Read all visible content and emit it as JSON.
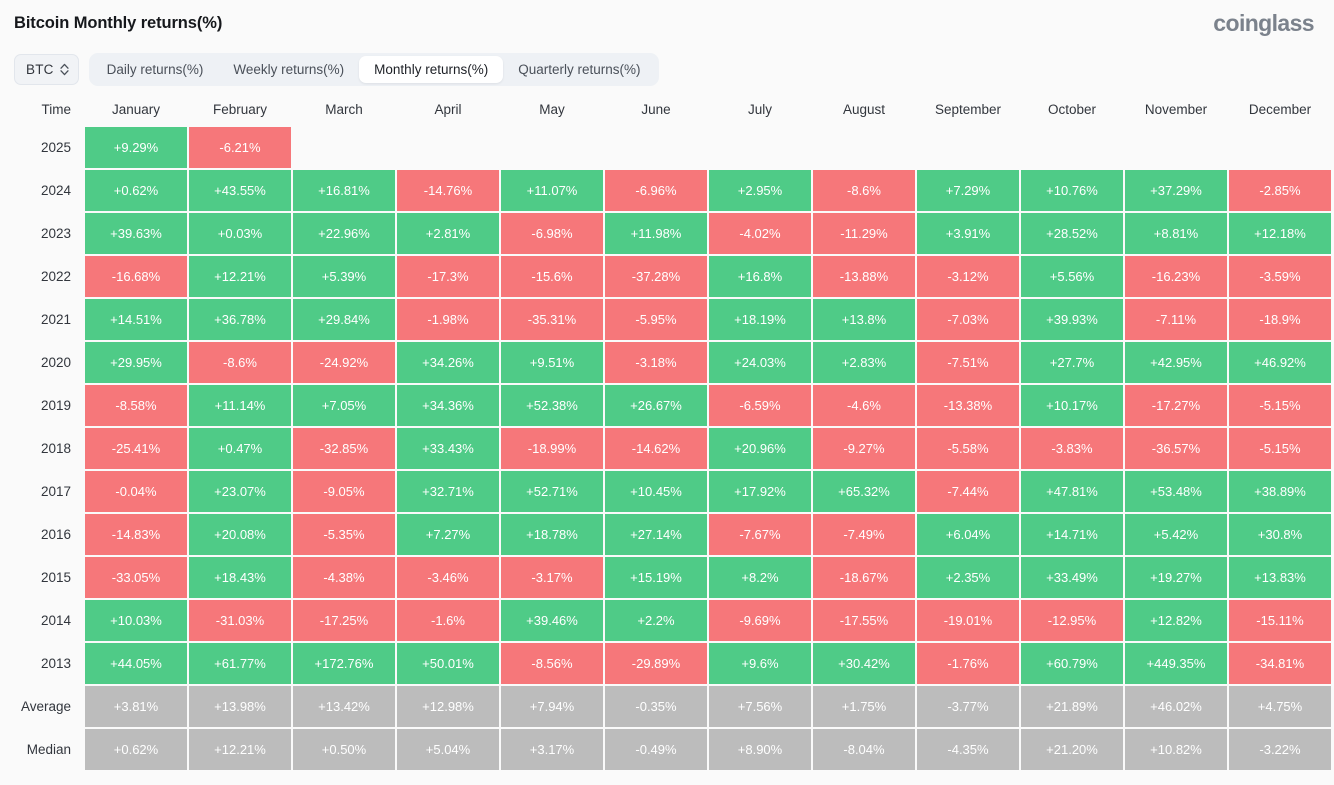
{
  "header": {
    "title": "Bitcoin Monthly returns(%)",
    "brand": "coinglass"
  },
  "controls": {
    "symbol": "BTC",
    "tabs": [
      {
        "label": "Daily returns(%)",
        "active": false
      },
      {
        "label": "Weekly returns(%)",
        "active": false
      },
      {
        "label": "Monthly returns(%)",
        "active": true
      },
      {
        "label": "Quarterly returns(%)",
        "active": false
      }
    ]
  },
  "colors": {
    "positive": "#4fcb87",
    "negative": "#f6777a",
    "neutral": "#bcbcbc",
    "background": "#fafafa",
    "tab_bar": "#eef1f5"
  },
  "chart_data": {
    "type": "heatmap",
    "title": "Bitcoin Monthly returns(%)",
    "xlabel": "",
    "ylabel": "Time",
    "row_header": "Time",
    "categories": [
      "January",
      "February",
      "March",
      "April",
      "May",
      "June",
      "July",
      "August",
      "September",
      "October",
      "November",
      "December"
    ],
    "rows": [
      {
        "label": "2025",
        "kind": "year",
        "values": [
          "+9.29%",
          "-6.21%",
          "",
          "",
          "",
          "",
          "",
          "",
          "",
          "",
          "",
          ""
        ]
      },
      {
        "label": "2024",
        "kind": "year",
        "values": [
          "+0.62%",
          "+43.55%",
          "+16.81%",
          "-14.76%",
          "+11.07%",
          "-6.96%",
          "+2.95%",
          "-8.6%",
          "+7.29%",
          "+10.76%",
          "+37.29%",
          "-2.85%"
        ]
      },
      {
        "label": "2023",
        "kind": "year",
        "values": [
          "+39.63%",
          "+0.03%",
          "+22.96%",
          "+2.81%",
          "-6.98%",
          "+11.98%",
          "-4.02%",
          "-11.29%",
          "+3.91%",
          "+28.52%",
          "+8.81%",
          "+12.18%"
        ]
      },
      {
        "label": "2022",
        "kind": "year",
        "values": [
          "-16.68%",
          "+12.21%",
          "+5.39%",
          "-17.3%",
          "-15.6%",
          "-37.28%",
          "+16.8%",
          "-13.88%",
          "-3.12%",
          "+5.56%",
          "-16.23%",
          "-3.59%"
        ]
      },
      {
        "label": "2021",
        "kind": "year",
        "values": [
          "+14.51%",
          "+36.78%",
          "+29.84%",
          "-1.98%",
          "-35.31%",
          "-5.95%",
          "+18.19%",
          "+13.8%",
          "-7.03%",
          "+39.93%",
          "-7.11%",
          "-18.9%"
        ]
      },
      {
        "label": "2020",
        "kind": "year",
        "values": [
          "+29.95%",
          "-8.6%",
          "-24.92%",
          "+34.26%",
          "+9.51%",
          "-3.18%",
          "+24.03%",
          "+2.83%",
          "-7.51%",
          "+27.7%",
          "+42.95%",
          "+46.92%"
        ]
      },
      {
        "label": "2019",
        "kind": "year",
        "values": [
          "-8.58%",
          "+11.14%",
          "+7.05%",
          "+34.36%",
          "+52.38%",
          "+26.67%",
          "-6.59%",
          "-4.6%",
          "-13.38%",
          "+10.17%",
          "-17.27%",
          "-5.15%"
        ]
      },
      {
        "label": "2018",
        "kind": "year",
        "values": [
          "-25.41%",
          "+0.47%",
          "-32.85%",
          "+33.43%",
          "-18.99%",
          "-14.62%",
          "+20.96%",
          "-9.27%",
          "-5.58%",
          "-3.83%",
          "-36.57%",
          "-5.15%"
        ]
      },
      {
        "label": "2017",
        "kind": "year",
        "values": [
          "-0.04%",
          "+23.07%",
          "-9.05%",
          "+32.71%",
          "+52.71%",
          "+10.45%",
          "+17.92%",
          "+65.32%",
          "-7.44%",
          "+47.81%",
          "+53.48%",
          "+38.89%"
        ]
      },
      {
        "label": "2016",
        "kind": "year",
        "values": [
          "-14.83%",
          "+20.08%",
          "-5.35%",
          "+7.27%",
          "+18.78%",
          "+27.14%",
          "-7.67%",
          "-7.49%",
          "+6.04%",
          "+14.71%",
          "+5.42%",
          "+30.8%"
        ]
      },
      {
        "label": "2015",
        "kind": "year",
        "values": [
          "-33.05%",
          "+18.43%",
          "-4.38%",
          "-3.46%",
          "-3.17%",
          "+15.19%",
          "+8.2%",
          "-18.67%",
          "+2.35%",
          "+33.49%",
          "+19.27%",
          "+13.83%"
        ]
      },
      {
        "label": "2014",
        "kind": "year",
        "values": [
          "+10.03%",
          "-31.03%",
          "-17.25%",
          "-1.6%",
          "+39.46%",
          "+2.2%",
          "-9.69%",
          "-17.55%",
          "-19.01%",
          "-12.95%",
          "+12.82%",
          "-15.11%"
        ]
      },
      {
        "label": "2013",
        "kind": "year",
        "values": [
          "+44.05%",
          "+61.77%",
          "+172.76%",
          "+50.01%",
          "-8.56%",
          "-29.89%",
          "+9.6%",
          "+30.42%",
          "-1.76%",
          "+60.79%",
          "+449.35%",
          "-34.81%"
        ]
      },
      {
        "label": "Average",
        "kind": "summary",
        "values": [
          "+3.81%",
          "+13.98%",
          "+13.42%",
          "+12.98%",
          "+7.94%",
          "-0.35%",
          "+7.56%",
          "+1.75%",
          "-3.77%",
          "+21.89%",
          "+46.02%",
          "+4.75%"
        ]
      },
      {
        "label": "Median",
        "kind": "summary",
        "values": [
          "+0.62%",
          "+12.21%",
          "+0.50%",
          "+5.04%",
          "+3.17%",
          "-0.49%",
          "+8.90%",
          "-8.04%",
          "-4.35%",
          "+21.20%",
          "+10.82%",
          "-3.22%"
        ]
      }
    ]
  }
}
